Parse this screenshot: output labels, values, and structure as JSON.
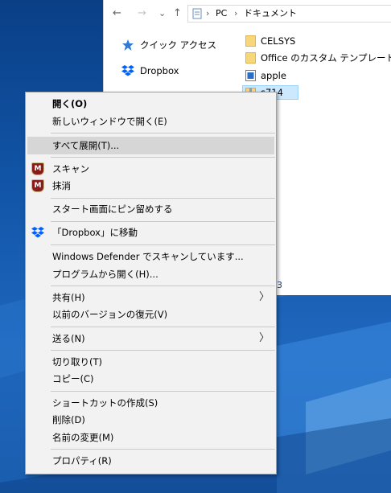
{
  "explorer": {
    "nav": {
      "back_glyph": "←",
      "forward_glyph": "→",
      "recent_glyph": "⌄",
      "up_glyph": "↑"
    },
    "breadcrumb": [
      "PC",
      "ドキュメント"
    ],
    "breadcrumb_separator": "›",
    "nav_pane": [
      {
        "label": "クイック アクセス",
        "icon": "star-icon"
      },
      {
        "label": "Dropbox",
        "icon": "dropbox-icon"
      }
    ],
    "files": [
      {
        "label": "CELSYS",
        "icon": "folder-icon"
      },
      {
        "label": "Office のカスタム テンプレート",
        "icon": "folder-icon"
      },
      {
        "label": "apple",
        "icon": "image-file-icon"
      },
      {
        "label": "s714",
        "icon": "zip-folder-icon",
        "selected": true
      }
    ],
    "peek_text": "3"
  },
  "context_menu": {
    "items": [
      {
        "label": "開く(O)",
        "bold": true
      },
      {
        "label": "新しいウィンドウで開く(E)"
      },
      {
        "label": "すべて展開(T)...",
        "highlighted": true
      },
      {
        "label": "スキャン",
        "icon": "mcafee-icon"
      },
      {
        "label": "抹消",
        "icon": "mcafee-icon"
      },
      {
        "label": "スタート画面にピン留めする"
      },
      {
        "label": "「Dropbox」に移動",
        "icon": "dropbox-icon"
      },
      {
        "label": "Windows Defender でスキャンしています..."
      },
      {
        "label": "プログラムから開く(H)..."
      },
      {
        "label": "共有(H)",
        "submenu": true
      },
      {
        "label": "以前のバージョンの復元(V)"
      },
      {
        "label": "送る(N)",
        "submenu": true
      },
      {
        "label": "切り取り(T)"
      },
      {
        "label": "コピー(C)"
      },
      {
        "label": "ショートカットの作成(S)"
      },
      {
        "label": "削除(D)"
      },
      {
        "label": "名前の変更(M)"
      },
      {
        "label": "プロパティ(R)"
      }
    ],
    "submenu_glyph": "〉",
    "mcafee_glyph": "M"
  },
  "colors": {
    "desktop": "#0f4ea0",
    "menu_bg": "#f2f2f2",
    "menu_highlight": "#d6d6d6",
    "selection": "#cce8ff",
    "mcafee_red": "#8a1b1b",
    "dropbox_blue": "#0061fe"
  }
}
